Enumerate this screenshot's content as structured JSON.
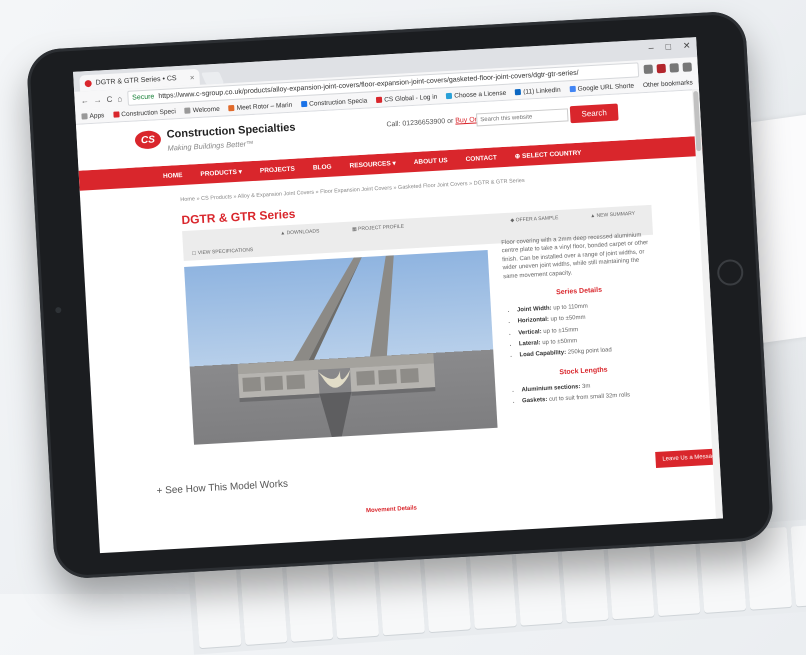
{
  "browser": {
    "tab_title": "DGTR & GTR Series • CS",
    "tab_close": "×",
    "window_controls": [
      "–",
      "□",
      "✕"
    ],
    "nav_buttons": [
      "←",
      "→",
      "C",
      "⌂"
    ],
    "secure_label": "Secure",
    "url": "https://www.c-sgroup.co.uk/products/alloy-expansion-joint-covers/floor-expansion-joint-covers/gasketed-floor-joint-covers/dgtr-gtr-series/",
    "bookmarks": [
      "Apps",
      "Construction Speci",
      "Welcome",
      "Meet Rotor – Marin",
      "Construction Specia",
      "CS Global - Log in",
      "Choose a License",
      "(11) LinkedIn",
      "Google URL Shorte"
    ],
    "other_bookmarks": "Other bookmarks"
  },
  "site": {
    "logo_text": "CS",
    "brand": "Construction Specialties",
    "tagline": "Making Buildings Better™",
    "call_text": "Call: 01236653900 or",
    "call_link": "Buy Online",
    "search_placeholder": "Search this website",
    "search_button": "Search",
    "nav": [
      "HOME",
      "PRODUCTS ▾",
      "PROJECTS",
      "BLOG",
      "RESOURCES ▾",
      "ABOUT US",
      "CONTACT",
      "⊕ SELECT COUNTRY"
    ]
  },
  "page": {
    "breadcrumb": "Home » CS Products » Alloy & Expansion Joint Covers » Floor Expansion Joint Covers » Gasketed Floor Joint Covers » DGTR & GTR Series",
    "title": "DGTR & GTR Series",
    "features": [
      "",
      "▲ DOWNLOADS",
      "▦ PROJECT PROFILE",
      "",
      "◆ OFFER A SAMPLE",
      "▲ NEW SUMMARY",
      "▢ VIEW SPECIFICATIONS",
      "",
      "",
      "",
      "",
      ""
    ],
    "description": "Floor covering with a 2mm deep recessed aluminium centre plate to take a vinyl floor, bonded carpet or other finish. Can be installed over a range of joint widths, or wider uneven joint widths, while still maintaining the same movement capacity.",
    "series_details_heading": "Series Details",
    "series_details": [
      {
        "label": "Joint Width:",
        "value": "up to 110mm"
      },
      {
        "label": "Horizontal:",
        "value": "up to ±50mm"
      },
      {
        "label": "Vertical:",
        "value": "up to ±15mm"
      },
      {
        "label": "Lateral:",
        "value": "up to ±50mm"
      },
      {
        "label": "Load Capability:",
        "value": "250kg point load"
      }
    ],
    "stock_lengths_heading": "Stock Lengths",
    "stock_lengths": [
      {
        "label": "Aluminium sections:",
        "value": "3m"
      },
      {
        "label": "Gaskets:",
        "value": "cut to suit from small 32m rolls"
      }
    ],
    "see_how": "See How This Model Works",
    "see_how_icon": "+",
    "movement_details": "Movement Details",
    "leave_message": "Leave Us a Message"
  },
  "colors": {
    "brand_red": "#d9262c",
    "sky": "#a9c4e6",
    "ground": "#858587"
  }
}
